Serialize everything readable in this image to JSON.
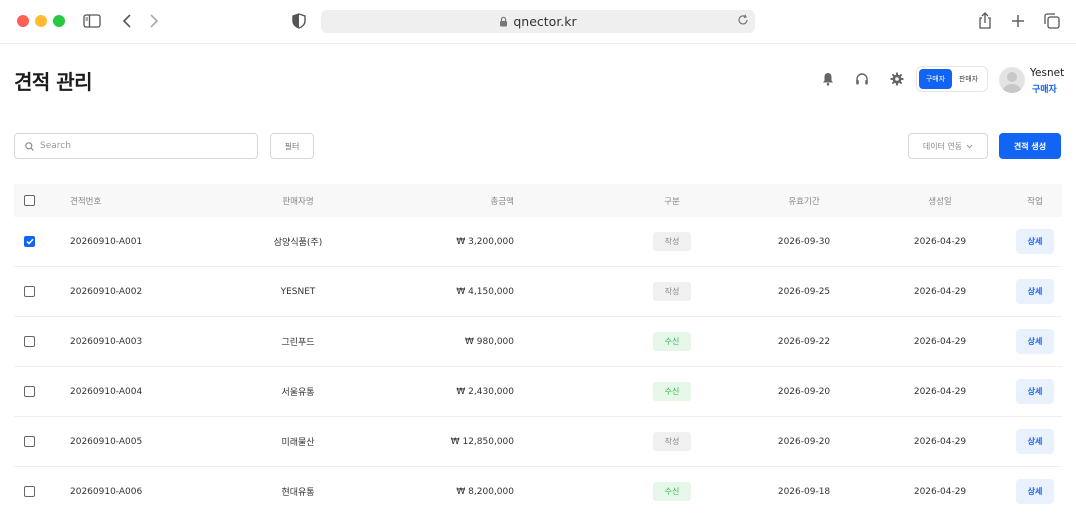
{
  "browser": {
    "url": "qnector.kr"
  },
  "header": {
    "title": "견적 관리",
    "role_toggle": {
      "buyer": "구매자",
      "seller": "판매자",
      "active": "buyer"
    },
    "user": {
      "name": "Yesnet",
      "role": "구매자"
    }
  },
  "toolbar": {
    "search_placeholder": "Search",
    "filter_label": "필터",
    "data_link_label": "데이터 연동",
    "create_label": "견적 생성"
  },
  "table": {
    "columns": [
      "견적번호",
      "판매자명",
      "총금액",
      "구분",
      "유효기간",
      "생성일",
      "작업"
    ],
    "rows": [
      {
        "id": "20260910-A001",
        "seller": "삼양식품(주)",
        "amount": "₩ 3,200,000",
        "type": "작성",
        "type_kind": "draft",
        "valid_until": "2026-09-30",
        "created": "2026-04-29",
        "action": "상세",
        "checked": true
      },
      {
        "id": "20260910-A002",
        "seller": "YESNET",
        "amount": "₩ 4,150,000",
        "type": "작성",
        "type_kind": "draft",
        "valid_until": "2026-09-25",
        "created": "2026-04-29",
        "action": "상세",
        "checked": false
      },
      {
        "id": "20260910-A003",
        "seller": "그린푸드",
        "amount": "₩ 980,000",
        "type": "수신",
        "type_kind": "received",
        "valid_until": "2026-09-22",
        "created": "2026-04-29",
        "action": "상세",
        "checked": false
      },
      {
        "id": "20260910-A004",
        "seller": "서울유통",
        "amount": "₩ 2,430,000",
        "type": "수신",
        "type_kind": "received",
        "valid_until": "2026-09-20",
        "created": "2026-04-29",
        "action": "상세",
        "checked": false
      },
      {
        "id": "20260910-A005",
        "seller": "미래물산",
        "amount": "₩ 12,850,000",
        "type": "작성",
        "type_kind": "draft",
        "valid_until": "2026-09-20",
        "created": "2026-04-29",
        "action": "상세",
        "checked": false
      },
      {
        "id": "20260910-A006",
        "seller": "현대유통",
        "amount": "₩ 8,200,000",
        "type": "수신",
        "type_kind": "received",
        "valid_until": "2026-09-18",
        "created": "2026-04-29",
        "action": "상세",
        "checked": false
      }
    ]
  },
  "colors": {
    "accent": "#1264f5",
    "badge_draft_bg": "#f0f0f1",
    "badge_received_bg": "#e6f7ea",
    "badge_received_text": "#2bb24c"
  },
  "icons": {
    "sidebar_toggle": "sidebar-icon",
    "back": "chevron-left-icon",
    "forward": "chevron-right-icon",
    "shield": "shield-icon",
    "lock": "lock-icon",
    "reload": "reload-icon",
    "share": "share-icon",
    "new_tab": "plus-icon",
    "tabs": "tabs-icon",
    "notifications": "bell-icon",
    "support": "headset-icon",
    "settings": "gear-icon",
    "search": "search-icon"
  }
}
